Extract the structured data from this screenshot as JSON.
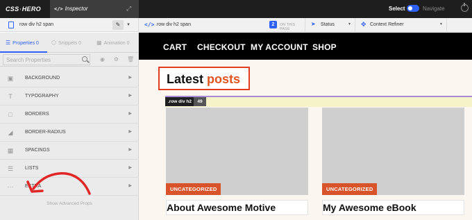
{
  "app": {
    "logo_left": "CSS",
    "logo_right": "HERO",
    "inspector_icon": "</>",
    "inspector_label": "Inspector",
    "mode_select": "Select",
    "mode_navigate": "Navigate",
    "accent_color": "#2e61f5"
  },
  "selector_bar": {
    "selector": "row div h2 span",
    "path_selector": ".row div h2 span",
    "page_count": "2",
    "on_page": "ON THIS PAGE",
    "status_label": "Status",
    "context_label": "Context Refiner"
  },
  "panel": {
    "tabs": [
      {
        "label": "Properties 0",
        "icon": "list-icon"
      },
      {
        "label": "Snippets 0",
        "icon": "cube-icon"
      },
      {
        "label": "Animation 0",
        "icon": "animation-icon"
      }
    ],
    "search_placeholder": "Search Properties",
    "properties": [
      {
        "label": "BACKGROUND",
        "icon": "background-icon"
      },
      {
        "label": "TYPOGRAPHY",
        "icon": "typography-icon"
      },
      {
        "label": "BORDERS",
        "icon": "borders-icon"
      },
      {
        "label": "BORDER-RADIUS",
        "icon": "border-radius-icon"
      },
      {
        "label": "SPACINGS",
        "icon": "spacings-icon"
      },
      {
        "label": "LISTS",
        "icon": "lists-icon"
      },
      {
        "label": "EXTRA",
        "icon": "more-icon"
      }
    ],
    "show_advanced": "Show Advanced Props"
  },
  "site": {
    "nav": [
      "CART",
      "CHECKOUT",
      "MY ACCOUNT",
      "SHOP"
    ],
    "heading_main": "Latest",
    "heading_accent": "posts",
    "chip_label": ".row div h2",
    "chip_count": "49",
    "cards": [
      {
        "category": "UNCATEGORIZED",
        "title": "About Awesome Motive"
      },
      {
        "category": "UNCATEGORIZED",
        "title": "My Awesome eBook"
      }
    ],
    "heading_accent_color": "#e0551f",
    "badge_color": "#d9532a"
  }
}
